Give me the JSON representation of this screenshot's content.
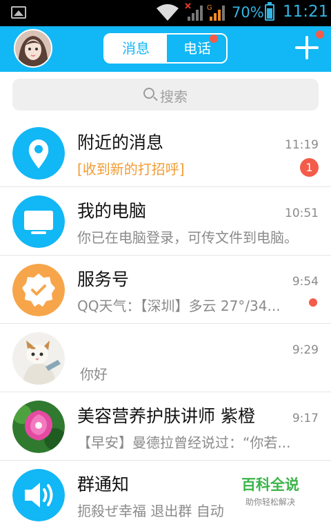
{
  "status_bar": {
    "battery_percent": "70%",
    "time": "11:21",
    "network_label": "G"
  },
  "header": {
    "tabs": [
      {
        "label": "消息",
        "active": true
      },
      {
        "label": "电话",
        "active": false,
        "has_dot": true
      }
    ],
    "add_has_dot": true
  },
  "search": {
    "placeholder": "搜索"
  },
  "conversations": [
    {
      "title": "附近的消息",
      "subtitle": "[收到新的打招呼]",
      "time": "11:19",
      "badge": "1",
      "icon": "location-pin-icon",
      "color": "#12b7f5"
    },
    {
      "title": "我的电脑",
      "subtitle": "你已在电脑登录，可传文件到电脑。",
      "time": "10:51",
      "icon": "monitor-icon",
      "color": "#12b7f5"
    },
    {
      "title": "服务号",
      "subtitle": "QQ天气：【深圳】多云 27°/34...",
      "time": "9:54",
      "icon": "verified-badge-icon",
      "color": "#f7a54a",
      "has_dot": true
    },
    {
      "title": "",
      "subtitle": "你好",
      "time": "9:29",
      "icon": "cat-avatar"
    },
    {
      "title": "美容营养护肤讲师 紫橙",
      "subtitle": "【早安】曼德拉曾经说过：“你若...",
      "time": "9:17",
      "icon": "flower-avatar"
    },
    {
      "title": "群通知",
      "subtitle": "扼殺ぜ幸福 退出群 自动",
      "time": "",
      "icon": "speaker-icon",
      "color": "#12b7f5"
    }
  ],
  "watermark": {
    "title": "百科全说",
    "subtitle": "助你轻松解决"
  },
  "colors": {
    "accent": "#12b7f5",
    "badge_red": "#f35c4a",
    "orange": "#f39c34"
  }
}
